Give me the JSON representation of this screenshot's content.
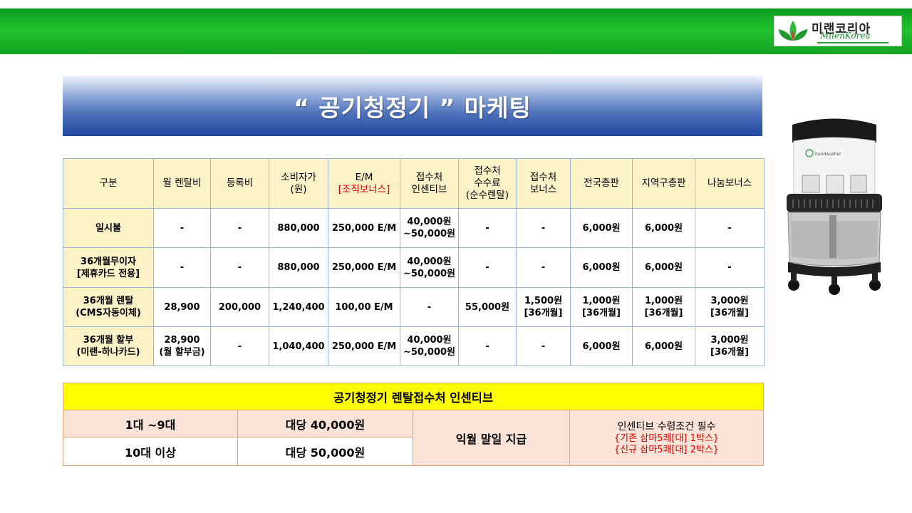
{
  "logo": {
    "korean": "미랜코리아",
    "english": "MilenKorea"
  },
  "title": "“ 공기청정기 ” 마케팅",
  "table": {
    "headers": [
      {
        "l1": "구분",
        "l2": "",
        "l3": ""
      },
      {
        "l1": "월 렌탈비",
        "l2": "",
        "l3": ""
      },
      {
        "l1": "등록비",
        "l2": "",
        "l3": ""
      },
      {
        "l1": "소비자가",
        "l2": "(원)",
        "l3": ""
      },
      {
        "l1": "E/M",
        "l2": "[조직보너스]",
        "l3": ""
      },
      {
        "l1": "접수처",
        "l2": "인센티브",
        "l3": ""
      },
      {
        "l1": "접수처",
        "l2": "수수료",
        "l3": "(순수렌탈)"
      },
      {
        "l1": "접수처",
        "l2": "보너스",
        "l3": ""
      },
      {
        "l1": "전국총판",
        "l2": "",
        "l3": ""
      },
      {
        "l1": "지역구총판",
        "l2": "",
        "l3": ""
      },
      {
        "l1": "나눔보너스",
        "l2": "",
        "l3": ""
      }
    ],
    "rows": [
      {
        "label": [
          "일시불",
          ""
        ],
        "cells": [
          [
            "-",
            ""
          ],
          [
            "-",
            ""
          ],
          [
            "880,000",
            ""
          ],
          [
            "250,000 E/M",
            ""
          ],
          [
            "40,000원",
            "~50,000원"
          ],
          [
            "-",
            ""
          ],
          [
            "-",
            ""
          ],
          [
            "6,000원",
            ""
          ],
          [
            "6,000원",
            ""
          ],
          [
            "-",
            ""
          ]
        ]
      },
      {
        "label": [
          "36개월무이자",
          "[제휴카드 전용]"
        ],
        "cells": [
          [
            "-",
            ""
          ],
          [
            "-",
            ""
          ],
          [
            "880,000",
            ""
          ],
          [
            "250,000 E/M",
            ""
          ],
          [
            "40,000원",
            "~50,000원"
          ],
          [
            "-",
            ""
          ],
          [
            "-",
            ""
          ],
          [
            "6,000원",
            ""
          ],
          [
            "6,000원",
            ""
          ],
          [
            "-",
            ""
          ]
        ]
      },
      {
        "label": [
          "36개월 렌탈",
          "(CMS자동이체)"
        ],
        "cells": [
          [
            "28,900",
            ""
          ],
          [
            "200,000",
            ""
          ],
          [
            "1,240,400",
            ""
          ],
          [
            "100,00 E/M",
            ""
          ],
          [
            "-",
            ""
          ],
          [
            "55,000원",
            ""
          ],
          [
            "1,500원",
            "[36개월]"
          ],
          [
            "1,000원",
            "[36개월]"
          ],
          [
            "1,000원",
            "[36개월]"
          ],
          [
            "3,000원",
            "[36개월]"
          ]
        ]
      },
      {
        "label": [
          "36개월 할부",
          "(미랜-하나카드)"
        ],
        "cells": [
          [
            "28,900",
            "(월 할부금)"
          ],
          [
            "-",
            ""
          ],
          [
            "1,040,400",
            ""
          ],
          [
            "250,000 E/M",
            ""
          ],
          [
            "40,000원",
            "~50,000원"
          ],
          [
            "-",
            ""
          ],
          [
            "-",
            ""
          ],
          [
            "6,000원",
            ""
          ],
          [
            "6,000원",
            ""
          ],
          [
            "3,000원",
            "[36개월]"
          ]
        ]
      }
    ]
  },
  "incentive": {
    "title": "공기청정기 렌탈접수처 인센티브",
    "rows": [
      {
        "qty": "1대 ~9대",
        "amount": "대당 40,000원"
      },
      {
        "qty": "10대 이상",
        "amount": "대당 50,000원"
      }
    ],
    "payment": "익월 말일 지급",
    "condition_title": "인센티브 수령조건 필수",
    "condition_1": "{기존 삼마5쾌[대] 1박스}",
    "condition_2": "{신규 삼마5쾌[대] 2박스}"
  },
  "product_label": "handwasher",
  "colors": {
    "green": "#22c32e",
    "blue": "#1e49a0",
    "header_bg": "#fdf1c8",
    "yellow": "#ffff00",
    "peach": "#fbe4d7",
    "red": "#e00000"
  }
}
